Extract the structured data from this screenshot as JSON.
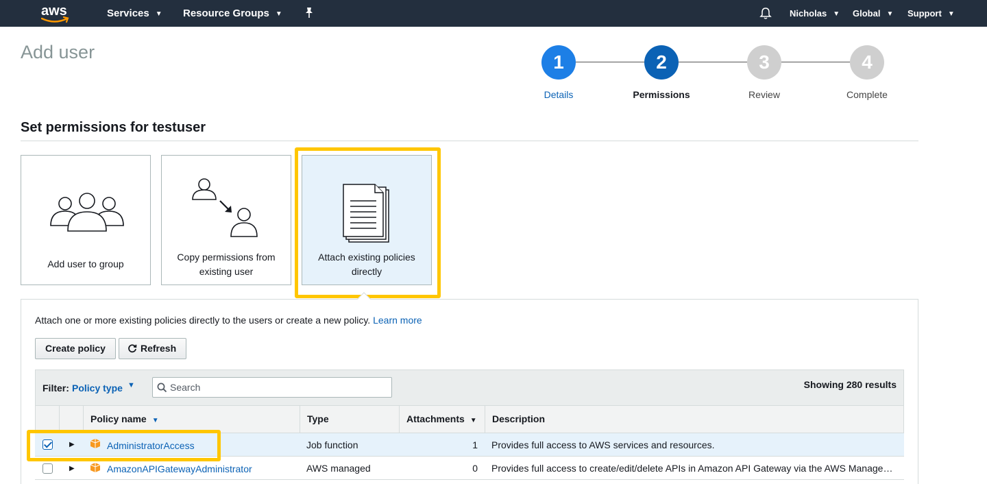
{
  "nav": {
    "logo_text": "aws",
    "services": "Services",
    "resource_groups": "Resource Groups",
    "user": "Nicholas",
    "region": "Global",
    "support": "Support"
  },
  "page": {
    "title": "Add user"
  },
  "steps": [
    {
      "num": "1",
      "label": "Details"
    },
    {
      "num": "2",
      "label": "Permissions"
    },
    {
      "num": "3",
      "label": "Review"
    },
    {
      "num": "4",
      "label": "Complete"
    }
  ],
  "section": {
    "title": "Set permissions for testuser"
  },
  "options": [
    {
      "label": "Add user to group"
    },
    {
      "label": "Copy permissions from existing user"
    },
    {
      "label": "Attach existing policies directly"
    }
  ],
  "panel": {
    "intro": "Attach one or more existing policies directly to the users or create a new policy.",
    "learn_more": "Learn more",
    "create_policy": "Create policy",
    "refresh": "Refresh"
  },
  "filter": {
    "label": "Filter:",
    "value": "Policy type",
    "search_placeholder": "Search",
    "results": "Showing 280 results"
  },
  "table": {
    "columns": [
      "Policy name",
      "Type",
      "Attachments",
      "Description"
    ],
    "rows": [
      {
        "name": "AdministratorAccess",
        "type": "Job function",
        "attachments": "1",
        "description": "Provides full access to AWS services and resources.",
        "checked": true
      },
      {
        "name": "AmazonAPIGatewayAdministrator",
        "type": "AWS managed",
        "attachments": "0",
        "description": "Provides full access to create/edit/delete APIs in Amazon API Gateway via the AWS Manage…",
        "checked": false
      }
    ]
  },
  "colors": {
    "nav_bg": "#232f3e",
    "accent_blue": "#0b62b5",
    "highlight_yellow": "#ffc600",
    "selected_bg": "#e6f2fb",
    "policy_icon_orange": "#f7981f"
  }
}
